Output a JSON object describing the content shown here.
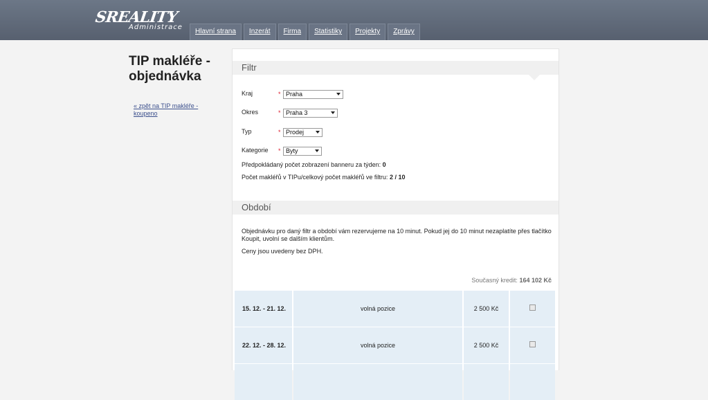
{
  "header": {
    "logo_main": "SREALITY",
    "logo_sub": "Administrace",
    "nav": [
      "Hlavní strana",
      "Inzerát",
      "Firma",
      "Statistiky",
      "Projekty",
      "Zprávy"
    ]
  },
  "sidebar": {
    "title": "TIP makléře - objednávka",
    "back_link": "« zpět na TIP makléře - koupeno"
  },
  "filter": {
    "heading": "Filtr",
    "fields": [
      {
        "label": "Kraj",
        "required": "*",
        "value": "Praha"
      },
      {
        "label": "Okres",
        "required": "*",
        "value": "Praha 3"
      },
      {
        "label": "Typ",
        "required": "*",
        "value": "Prodej"
      },
      {
        "label": "Kategorie",
        "required": "*",
        "value": "Byty"
      }
    ],
    "expected_views_label": "Předpokládaný počet zobrazení banneru za týden:",
    "expected_views_value": "0",
    "brokers_label": "Počet makléřů v TIPu/celkový počet makléřů ve filtru:",
    "brokers_value": "2 / 10"
  },
  "period": {
    "heading": "Období",
    "note": "Objednávku pro daný filtr a období vám rezervujeme na 10 minut. Pokud jej do 10 minut nezaplatíte přes tlačítko Koupit, uvolní se dalším klientům.",
    "vat_note": "Ceny jsou uvedeny bez DPH.",
    "credit_label": "Současný kredit:",
    "credit_value": "164 102 Kč",
    "rows": [
      {
        "dates": "15. 12. - 21. 12.",
        "status": "volná pozice",
        "price": "2 500 Kč"
      },
      {
        "dates": "22. 12. - 28. 12.",
        "status": "volná pozice",
        "price": "2 500 Kč"
      }
    ]
  }
}
